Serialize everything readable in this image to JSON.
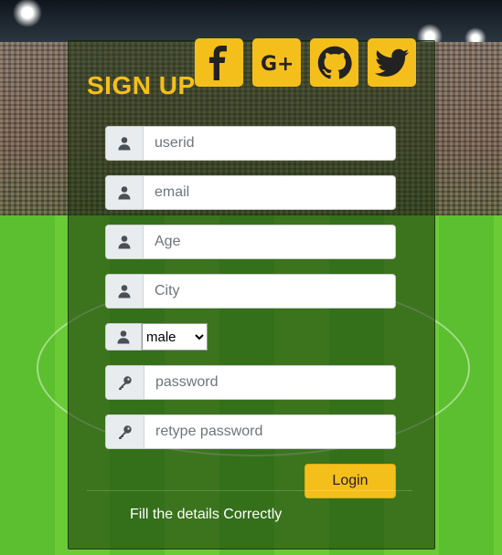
{
  "form": {
    "title": "SIGN UP",
    "fields": [
      {
        "name": "userid",
        "placeholder": "userid",
        "value": ""
      },
      {
        "name": "email",
        "placeholder": "email",
        "value": ""
      },
      {
        "name": "age",
        "placeholder": "Age",
        "value": ""
      },
      {
        "name": "city",
        "placeholder": "City",
        "value": ""
      }
    ],
    "gender": {
      "selected": "male"
    },
    "password": {
      "placeholder": "password",
      "value": ""
    },
    "retype_password": {
      "placeholder": "retype password",
      "value": ""
    },
    "login_label": "Login",
    "status_text": "Fill the details Correctly"
  },
  "social": [
    {
      "icon": "facebook-icon"
    },
    {
      "icon": "google-plus-icon",
      "label": "G+"
    },
    {
      "icon": "github-icon"
    },
    {
      "icon": "twitter-icon"
    }
  ],
  "colors": {
    "accent": "#f5bf1b",
    "panel": "rgba(20,45,10,0.55)",
    "text_on_panel": "#ffffff"
  }
}
